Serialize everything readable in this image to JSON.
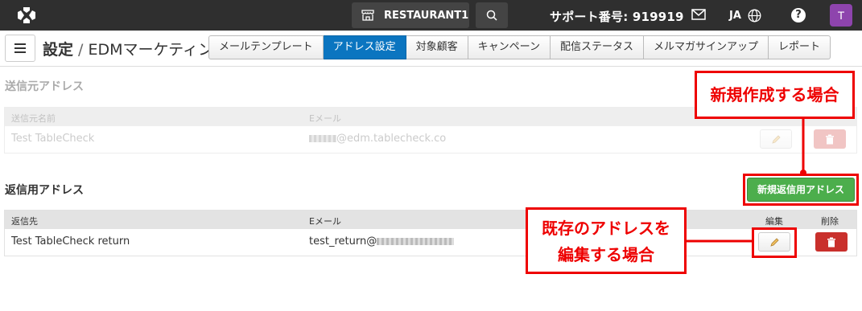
{
  "topbar": {
    "restaurant": "RESTAURANT1",
    "support": "サポート番号: 919919",
    "lang": "JA",
    "help": "?",
    "avatar": "T"
  },
  "breadcrumb": {
    "parent": "設定",
    "sep": " / ",
    "current": "EDMマーケティング"
  },
  "tabs": [
    {
      "label": "メールテンプレート",
      "active": false
    },
    {
      "label": "アドレス設定",
      "active": true
    },
    {
      "label": "対象顧客",
      "active": false
    },
    {
      "label": "キャンペーン",
      "active": false
    },
    {
      "label": "配信ステータス",
      "active": false
    },
    {
      "label": "メルマガサインアップ",
      "active": false
    },
    {
      "label": "レポート",
      "active": false
    }
  ],
  "sender": {
    "title": "送信元アドレス",
    "col_name": "送信元名前",
    "col_email": "Eメール",
    "row_name": "Test TableCheck",
    "row_email_suffix": "@edm.tablecheck.co"
  },
  "reply": {
    "title": "返信用アドレス",
    "new_button": "新規返信用アドレス",
    "col_name": "返信先",
    "col_email": "Eメール",
    "col_edit": "編集",
    "col_delete": "削除",
    "row_name": "Test TableCheck return",
    "row_email_prefix": "test_return@"
  },
  "annotations": {
    "new_case": "新規作成する場合",
    "edit_case_line1": "既存のアドレスを",
    "edit_case_line2": "編集する場合",
    "color": "#e00000"
  },
  "colors": {
    "topbar": "#2f2f2f",
    "active_tab": "#0b75c0",
    "new_button": "#4cae4c",
    "delete_button": "#c9302c",
    "avatar": "#8e44ad"
  }
}
